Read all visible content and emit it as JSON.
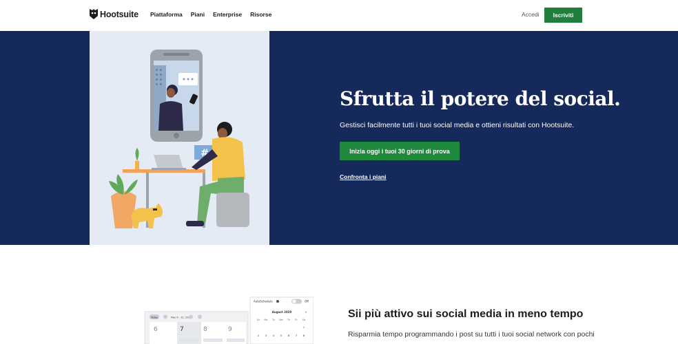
{
  "nav": {
    "logo": "Hootsuite",
    "links": [
      "Piattaforma",
      "Piani",
      "Enterprise",
      "Risorse"
    ],
    "login": "Accedi",
    "signup": "Iscriviti"
  },
  "hero": {
    "title": "Sfrutta il potere del social.",
    "subtitle": "Gestisci facilmente tutti i tuoi social media e ottieni risultati con Hootsuite.",
    "cta": "Inizia oggi i tuoi 30 giorni di prova",
    "compare_link": "Confronta i piani"
  },
  "feature": {
    "title": "Sii più attivo sui social media in meno tempo",
    "text": "Risparmia tempo programmando i post su tutti i tuoi social network con pochi",
    "mock": {
      "autoschedule_label": "AutoSchedule",
      "toggle_state": "Off",
      "calendar_month": "August 2020",
      "weekdays": [
        "Su",
        "Mo",
        "Tu",
        "We",
        "Th",
        "Fr",
        "Sa"
      ],
      "first_week": [
        "",
        "",
        "",
        "",
        "",
        "",
        "1"
      ],
      "second_week": [
        "2",
        "3",
        "4",
        "5",
        "6",
        "7",
        "8"
      ],
      "today_btn": "Today",
      "week_range": "May 6 - 12, 2020",
      "day_numbers": [
        "6",
        "7",
        "8",
        "9"
      ]
    }
  },
  "colors": {
    "brand_green": "#1f7f3b",
    "hero_bg": "#15295a",
    "illus_bg": "#e4ebf5"
  }
}
